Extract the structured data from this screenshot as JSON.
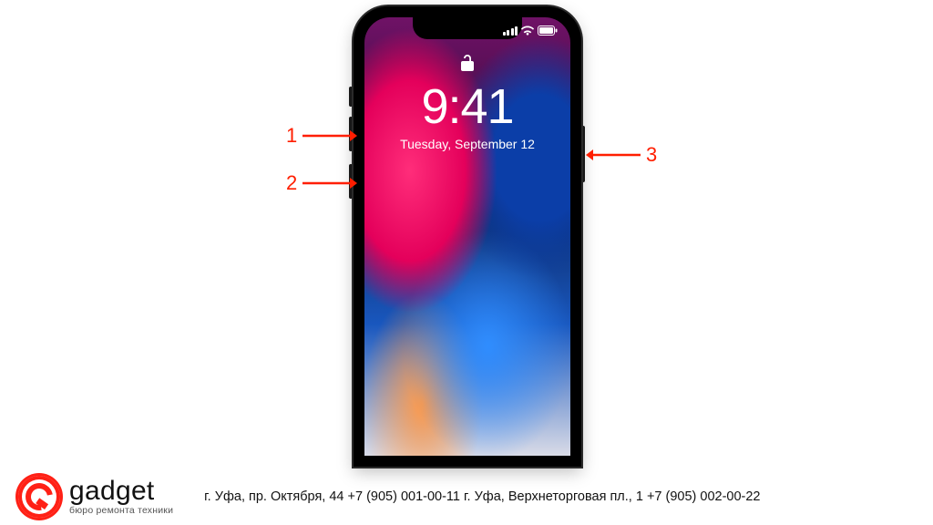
{
  "phone": {
    "time": "9:41",
    "date": "Tuesday, September 12"
  },
  "callouts": {
    "c1": "1",
    "c2": "2",
    "c3": "3"
  },
  "logo": {
    "name": "gadget",
    "tagline": "бюро ремонта техники"
  },
  "footer": {
    "address_line": "г. Уфа, пр. Октября, 44   +7 (905) 001-00-11 г. Уфа, Верхнеторговая пл., 1  +7 (905) 002-00-22"
  },
  "colors": {
    "accent_red": "#ff1e00"
  }
}
